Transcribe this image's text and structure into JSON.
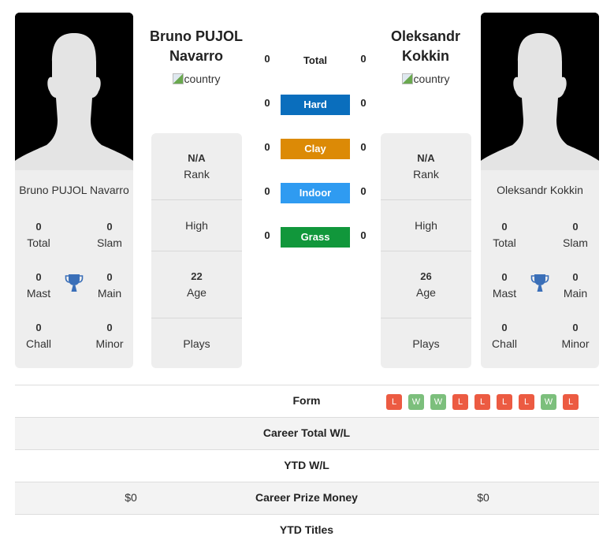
{
  "player1": {
    "name_full": "Bruno PUJOL Navarro",
    "name_line1": "Bruno PUJOL",
    "name_line2": "Navarro",
    "country_alt": "country",
    "rank_value": "N/A",
    "rank_label": "Rank",
    "high_label": "High",
    "age_value": "22",
    "age_label": "Age",
    "plays_label": "Plays",
    "titles": {
      "total": {
        "value": "0",
        "label": "Total"
      },
      "slam": {
        "value": "0",
        "label": "Slam"
      },
      "mast": {
        "value": "0",
        "label": "Mast"
      },
      "main": {
        "value": "0",
        "label": "Main"
      },
      "chall": {
        "value": "0",
        "label": "Chall"
      },
      "minor": {
        "value": "0",
        "label": "Minor"
      }
    },
    "prize_money": "$0"
  },
  "player2": {
    "name_full": "Oleksandr Kokkin",
    "name_line1": "Oleksandr",
    "name_line2": "Kokkin",
    "country_alt": "country",
    "rank_value": "N/A",
    "rank_label": "Rank",
    "high_label": "High",
    "age_value": "26",
    "age_label": "Age",
    "plays_label": "Plays",
    "titles": {
      "total": {
        "value": "0",
        "label": "Total"
      },
      "slam": {
        "value": "0",
        "label": "Slam"
      },
      "mast": {
        "value": "0",
        "label": "Mast"
      },
      "main": {
        "value": "0",
        "label": "Main"
      },
      "chall": {
        "value": "0",
        "label": "Chall"
      },
      "minor": {
        "value": "0",
        "label": "Minor"
      }
    },
    "prize_money": "$0"
  },
  "h2h": {
    "total": {
      "label": "Total",
      "p1": "0",
      "p2": "0"
    },
    "surfaces": [
      {
        "label": "Hard",
        "p1": "0",
        "p2": "0",
        "color": "#0a6ebd"
      },
      {
        "label": "Clay",
        "p1": "0",
        "p2": "0",
        "color": "#dc8a06"
      },
      {
        "label": "Indoor",
        "p1": "0",
        "p2": "0",
        "color": "#2f9bf1"
      },
      {
        "label": "Grass",
        "p1": "0",
        "p2": "0",
        "color": "#11973b"
      }
    ]
  },
  "comparison": {
    "form_label": "Form",
    "form_p2": [
      "L",
      "W",
      "W",
      "L",
      "L",
      "L",
      "L",
      "W",
      "L"
    ],
    "form_colors": {
      "W": "#7cbf7c",
      "L": "#ec5b42"
    },
    "career_wl_label": "Career Total W/L",
    "ytd_wl_label": "YTD W/L",
    "prize_label": "Career Prize Money",
    "ytd_titles_label": "YTD Titles"
  },
  "icons": {
    "trophy": "trophy-icon",
    "avatar": "player-silhouette"
  }
}
